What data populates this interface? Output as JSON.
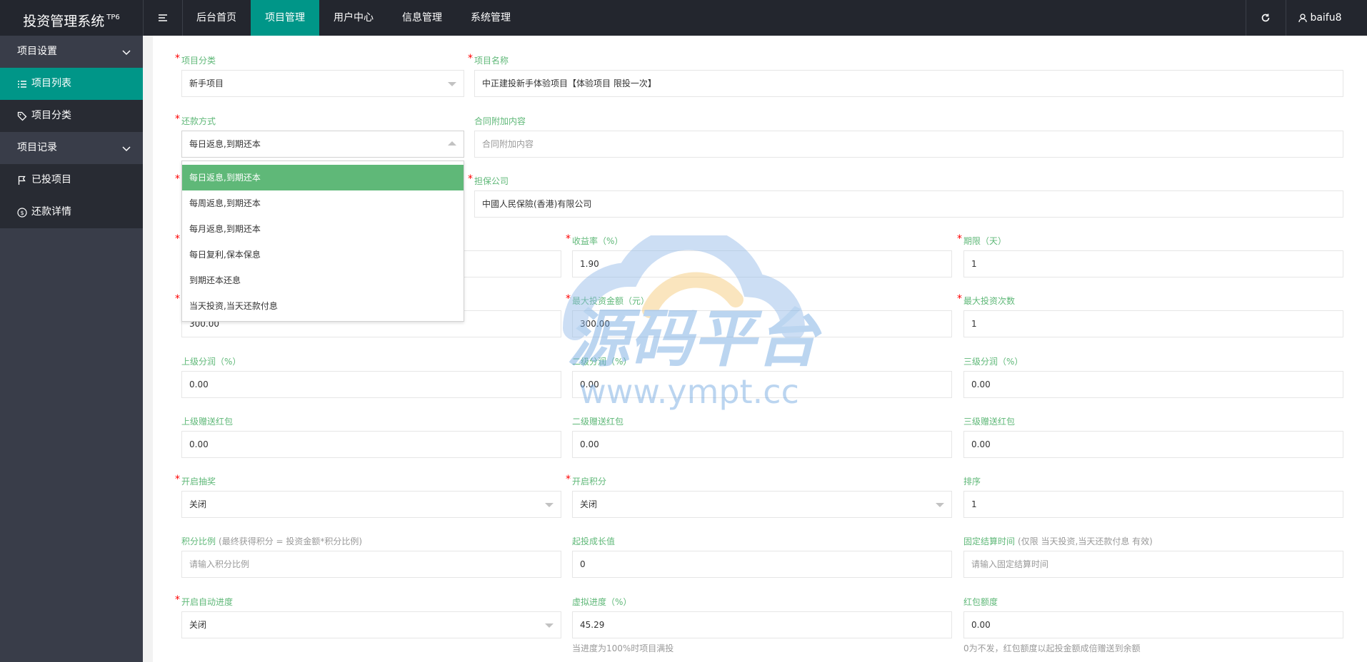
{
  "app": {
    "title": "投资管理系统",
    "badge": "TP6"
  },
  "topnav": {
    "items": [
      {
        "label": "后台首页"
      },
      {
        "label": "项目管理"
      },
      {
        "label": "用户中心"
      },
      {
        "label": "信息管理"
      },
      {
        "label": "系统管理"
      }
    ],
    "active_index": 1,
    "user": "baifu8"
  },
  "sidebar": {
    "groups": [
      {
        "label": "项目设置",
        "items": [
          {
            "label": "项目列表"
          },
          {
            "label": "项目分类"
          }
        ]
      },
      {
        "label": "项目记录",
        "items": [
          {
            "label": "已投项目"
          },
          {
            "label": "还款详情"
          }
        ]
      }
    ]
  },
  "form": {
    "category": {
      "label": "项目分类",
      "value": "新手项目"
    },
    "name": {
      "label": "项目名称",
      "value": "中正建投新手体验项目【体验项目 限投一次】"
    },
    "repay": {
      "label": "还款方式",
      "value": "每日返息,到期还本"
    },
    "contract": {
      "label": "合同附加内容",
      "placeholder": "合同附加内容"
    },
    "guarantor": {
      "label": "担保公司",
      "value": "中國人民保險(香港)有限公司"
    },
    "rate": {
      "label": "收益率（%）",
      "value": "1.90"
    },
    "period": {
      "label": "期限（天）",
      "value": "1"
    },
    "min_invest": {
      "value": "300.00"
    },
    "max_invest": {
      "label": "最大投资金额（元）",
      "value": "300.00"
    },
    "max_times": {
      "label": "最大投资次数",
      "value": "1"
    },
    "share1": {
      "label": "上级分润（%）",
      "value": "0.00"
    },
    "share2": {
      "label": "二级分润（%）",
      "value": "0.00"
    },
    "share3": {
      "label": "三级分润（%）",
      "value": "0.00"
    },
    "redpack1": {
      "label": "上级赠送红包",
      "value": "0.00"
    },
    "redpack2": {
      "label": "二级赠送红包",
      "value": "0.00"
    },
    "redpack3": {
      "label": "三级赠送红包",
      "value": "0.00"
    },
    "lottery": {
      "label": "开启抽奖",
      "value": "关闭"
    },
    "points": {
      "label": "开启积分",
      "value": "关闭"
    },
    "sort": {
      "label": "排序",
      "value": "1"
    },
    "points_ratio": {
      "label": "积分比例",
      "hint": "(最终获得积分 = 投资金额*积分比例)",
      "placeholder": "请输入积分比例"
    },
    "growth": {
      "label": "起投成长值",
      "value": "0"
    },
    "settle_time": {
      "label": "固定结算时间",
      "hint": "(仅限 当天投资,当天还款付息 有效)",
      "placeholder": "请输入固定结算时间"
    },
    "auto_progress": {
      "label": "开启自动进度",
      "value": "关闭"
    },
    "virtual_progress": {
      "label": "虚拟进度（%）",
      "value": "45.29",
      "hint": "当进度为100%时项目满投"
    },
    "redpack_amount": {
      "label": "红包额度",
      "value": "0.00",
      "hint": "0为不发，红包额度以起投金额成倍赠送到余额"
    }
  },
  "repay_options": [
    "每日返息,到期还本",
    "每周返息,到期还本",
    "每月返息,到期还本",
    "每日复利,保本保息",
    "到期还本还息",
    "当天投资,当天还款付息"
  ],
  "watermark": {
    "title": "源码平台",
    "url": "www.ympt.cc"
  },
  "colors": {
    "header": "#23262e",
    "sidebar": "#393d49",
    "accent": "#009688",
    "label": "#5fb878",
    "required": "#ff0000"
  }
}
